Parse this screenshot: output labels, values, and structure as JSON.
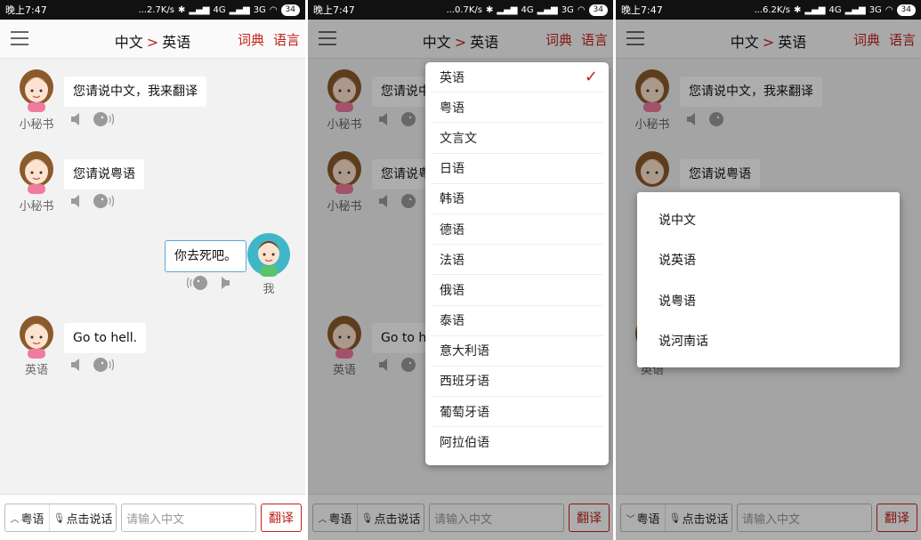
{
  "screens": [
    {
      "status": {
        "time": "晚上7:47",
        "speed": "...2.7K/s",
        "net1": "4G",
        "net2": "3G",
        "battery": "34"
      },
      "header": {
        "from": "中文",
        "arrow": ">",
        "to": "英语",
        "dict": "词典",
        "voice": "语言"
      },
      "messages": [
        {
          "name": "小秘书",
          "text": "您请说中文，我来翻译"
        },
        {
          "name": "小秘书",
          "text": "您请说粤语"
        },
        {
          "name": "我",
          "text": "你去死吧。"
        },
        {
          "name": "英语",
          "text": "Go to hell."
        }
      ],
      "bottom": {
        "lang": "粤语",
        "speak": "点击说话",
        "placeholder": "请输入中文",
        "translate": "翻译"
      }
    },
    {
      "status": {
        "time": "晚上7:47",
        "speed": "...0.7K/s",
        "net1": "4G",
        "net2": "3G",
        "battery": "34"
      },
      "header": {
        "from": "中文",
        "arrow": ">",
        "to": "英语",
        "dict": "词典",
        "voice": "语言"
      },
      "messages": [
        {
          "name": "小秘书",
          "text": "您请说中"
        },
        {
          "name": "小秘书",
          "text": "您请说粤"
        },
        {
          "name": "英语",
          "text": "Go to he"
        }
      ],
      "dropdown": {
        "items": [
          "英语",
          "粤语",
          "文言文",
          "日语",
          "韩语",
          "德语",
          "法语",
          "俄语",
          "泰语",
          "意大利语",
          "西班牙语",
          "葡萄牙语",
          "阿拉伯语"
        ],
        "selected": "英语",
        "checkmark": "✓"
      },
      "bottom": {
        "lang": "粤语",
        "speak": "点击说话",
        "placeholder": "请输入中文",
        "translate": "翻译"
      }
    },
    {
      "status": {
        "time": "晚上7:47",
        "speed": "...6.2K/s",
        "net1": "4G",
        "net2": "3G",
        "battery": "34"
      },
      "header": {
        "from": "中文",
        "arrow": ">",
        "to": "英语",
        "dict": "词典",
        "voice": "语言"
      },
      "messages": [
        {
          "name": "小秘书",
          "text": "您请说中文，我来翻译"
        },
        {
          "name": "",
          "text": "您请说粤语"
        },
        {
          "name": "英语",
          "text": ""
        }
      ],
      "dialog": {
        "items": [
          "说中文",
          "说英语",
          "说粤语",
          "说河南话"
        ]
      },
      "bottom": {
        "lang": "粤语",
        "speak": "点击说话",
        "placeholder": "请输入中文",
        "translate": "翻译"
      }
    }
  ],
  "colors": {
    "accent": "#c0221c",
    "bubble_border_me": "#5aa7d8",
    "background": "#f2f2f2"
  },
  "icons": [
    "menu-icon",
    "speaker-icon",
    "face-sound-icon",
    "chevron-up-icon",
    "chevron-down-icon",
    "mic-icon",
    "check-icon"
  ]
}
